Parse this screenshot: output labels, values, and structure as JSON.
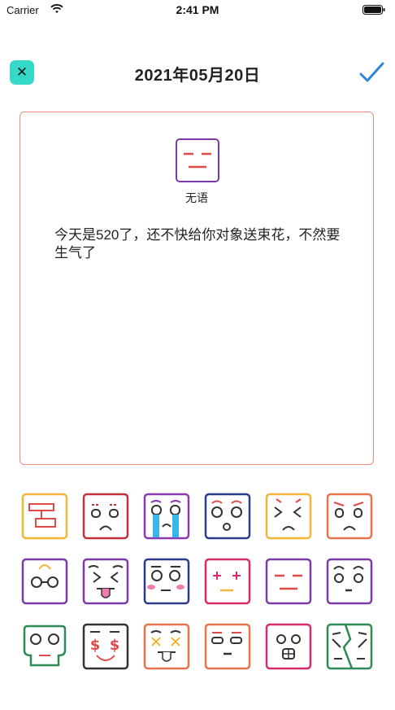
{
  "status_bar": {
    "carrier": "Carrier",
    "time": "2:41 PM"
  },
  "nav": {
    "title": "2021年05月20日",
    "close_icon": "close-icon",
    "confirm_icon": "checkmark-icon"
  },
  "entry": {
    "mood_label": "无语",
    "text": "今天是520了，还不快给你对象送束花，不然要生气了"
  },
  "colors": {
    "accent_teal": "#35d9c7",
    "check_blue": "#2f86d9",
    "card_border": "#f08b7f"
  },
  "faces": [
    "robot-face-icon",
    "sad-face-icon",
    "crying-face-icon",
    "surprised-face-icon",
    "annoyed-face-icon",
    "upset-face-icon",
    "glasses-face-icon",
    "tongue-face-icon",
    "blushing-face-icon",
    "plus-eyes-face-icon",
    "speechless-face-icon",
    "worried-face-icon",
    "skull-face-icon",
    "money-face-icon",
    "dizzy-face-icon",
    "bored-face-icon",
    "nose-face-icon",
    "broken-face-icon"
  ]
}
